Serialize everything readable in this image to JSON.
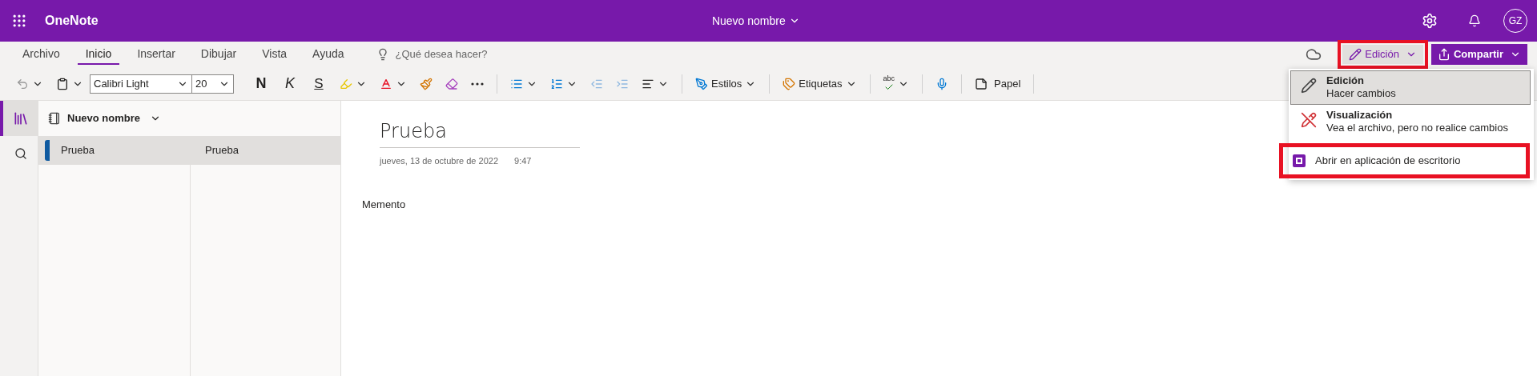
{
  "header": {
    "app_name": "OneNote",
    "document_title": "Nuevo nombre",
    "avatar": "GZ"
  },
  "ribbon_tabs": [
    {
      "label": "Archivo",
      "selected": false
    },
    {
      "label": "Inicio",
      "selected": true
    },
    {
      "label": "Insertar",
      "selected": false
    },
    {
      "label": "Dibujar",
      "selected": false
    },
    {
      "label": "Vista",
      "selected": false
    },
    {
      "label": "Ayuda",
      "selected": false
    }
  ],
  "tell_me": {
    "placeholder": "¿Qué desea hacer?"
  },
  "mode_button": {
    "label": "Edición",
    "highlighted": true
  },
  "share_button": {
    "label": "Compartir"
  },
  "toolbar": {
    "font": "Calibri Light",
    "size": "20",
    "bold": "N",
    "italic": "K",
    "underline": "S",
    "styles": "Estilos",
    "tags": "Etiquetas",
    "spelling": "abc",
    "paper": "Papel"
  },
  "mode_menu": [
    {
      "kind": "mode",
      "title": "Edición",
      "subtitle": "Hacer cambios",
      "selected": true
    },
    {
      "kind": "mode",
      "title": "Visualización",
      "subtitle": "Vea el archivo, pero no realice cambios",
      "selected": false
    },
    {
      "kind": "action",
      "title": "Abrir en aplicación de escritorio",
      "highlighted": true
    }
  ],
  "rail": [
    {
      "kind": "notebooks",
      "selected": true
    },
    {
      "kind": "search",
      "selected": false
    }
  ],
  "notebook": {
    "name": "Nuevo nombre"
  },
  "sections": [
    {
      "label": "Prueba",
      "selected": true,
      "color": "#0f5aa0"
    }
  ],
  "pages": [
    {
      "label": "Prueba",
      "selected": true
    }
  ],
  "page": {
    "title": "Prueba",
    "date": "jueves, 13 de octubre de 2022",
    "time": "9:47",
    "body": "Memento"
  }
}
